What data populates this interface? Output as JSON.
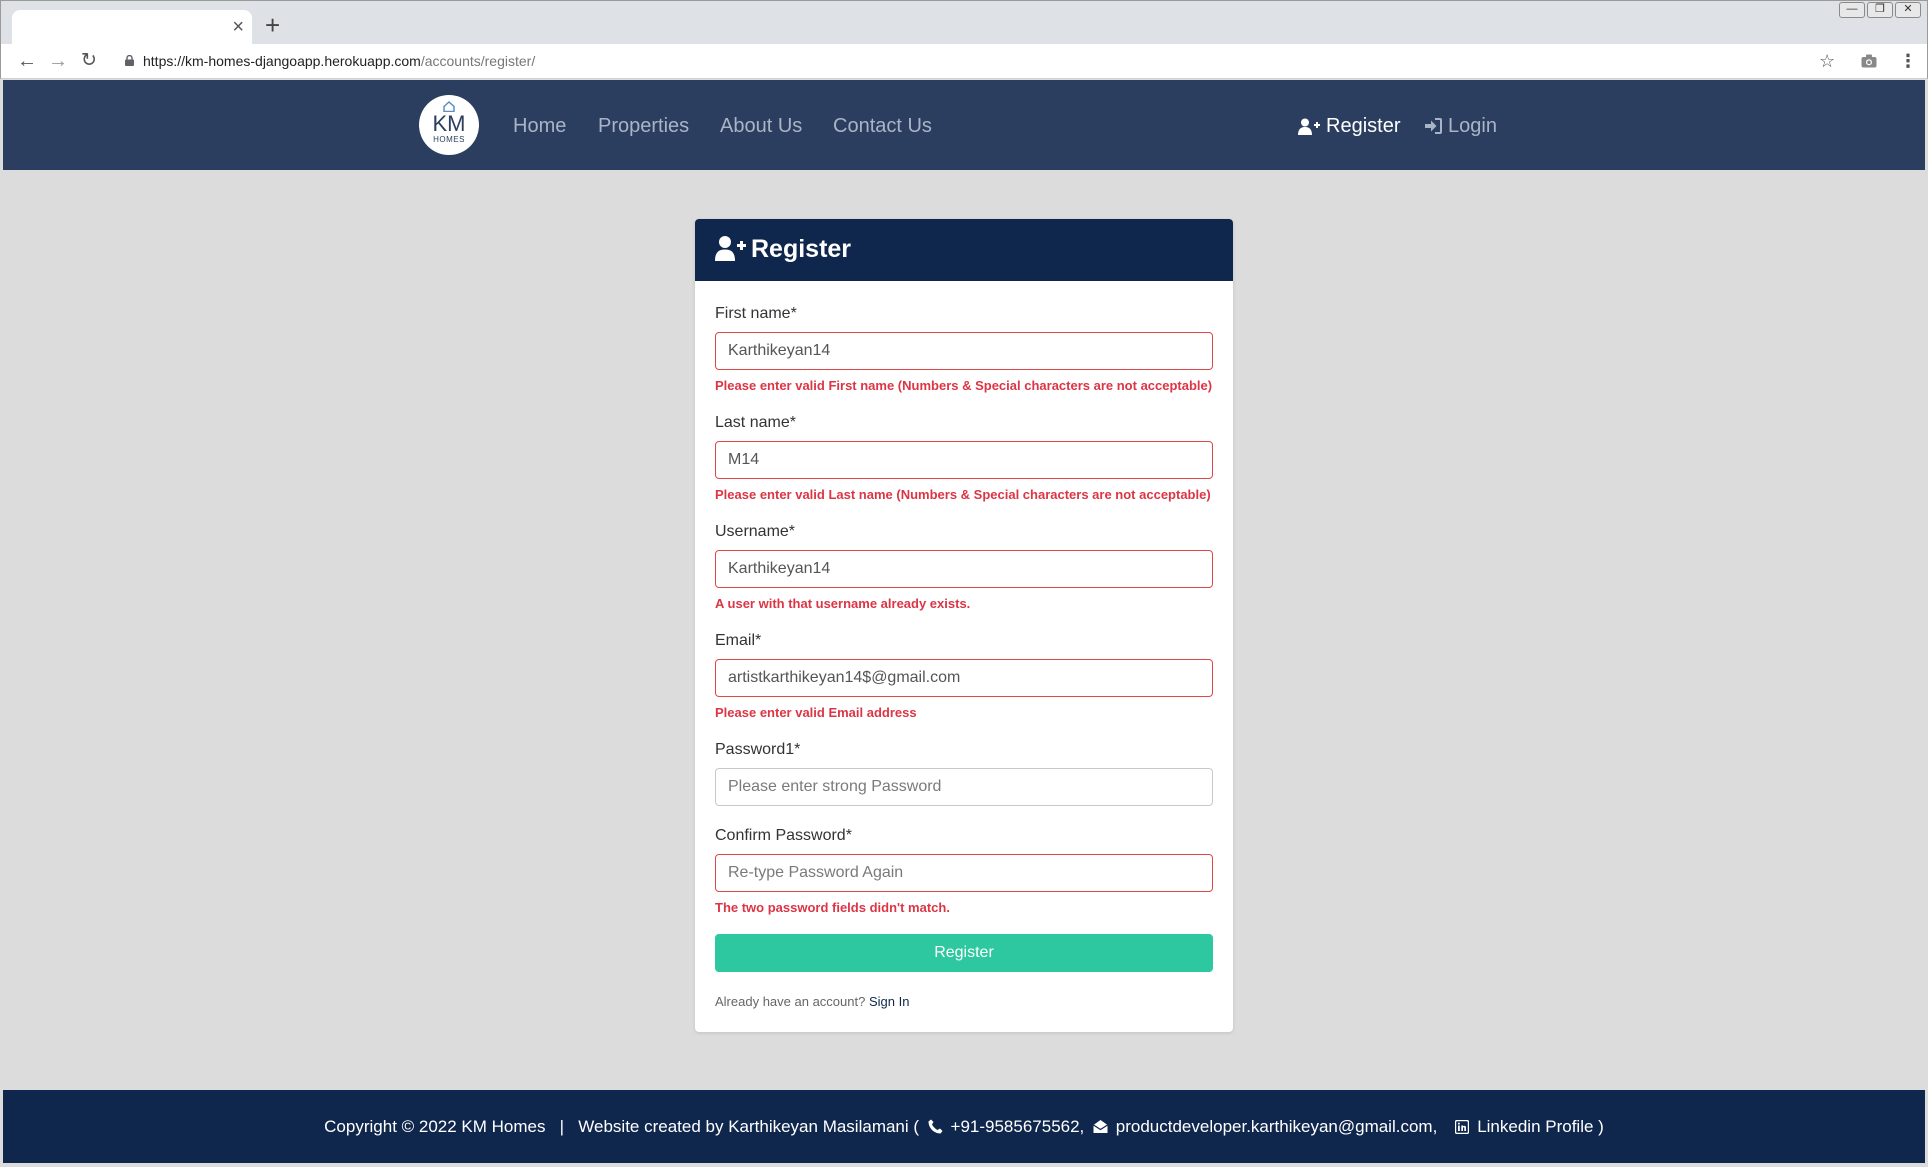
{
  "browser": {
    "url_host": "https://km-homes-djangoapp.herokuapp.com",
    "url_path": "/accounts/register/",
    "new_tab_glyph": "+",
    "close_tab_glyph": "×"
  },
  "navbar": {
    "logo_km": "KM",
    "logo_homes": "HOMES",
    "links": [
      "Home",
      "Properties",
      "About Us",
      "Contact Us"
    ],
    "register": "Register",
    "login": "Login"
  },
  "form": {
    "title": "Register",
    "first_name": {
      "label": "First name*",
      "value": "Karthikeyan14",
      "error": "Please enter valid First name (Numbers & Special characters are not acceptable)"
    },
    "last_name": {
      "label": "Last name*",
      "value": "M14",
      "error": "Please enter valid Last name (Numbers & Special characters are not acceptable)"
    },
    "username": {
      "label": "Username*",
      "value": "Karthikeyan14",
      "error": "A user with that username already exists."
    },
    "email": {
      "label": "Email*",
      "value": "artistkarthikeyan14$@gmail.com",
      "error": "Please enter valid Email address"
    },
    "password1": {
      "label": "Password1*",
      "placeholder": "Please enter strong Password"
    },
    "password2": {
      "label": "Confirm Password*",
      "placeholder": "Re-type Password Again",
      "error": "The two password fields didn't match."
    },
    "submit": "Register",
    "already": "Already have an account?",
    "signin": "Sign In"
  },
  "footer": {
    "copyright": "Copyright © 2022 KM Homes",
    "separator": "|",
    "created_by": "Website created by Karthikeyan Masilamani (",
    "phone": "+91-9585675562,",
    "email": "productdeveloper.karthikeyan@gmail.com,",
    "linkedin": "Linkedin Profile )"
  },
  "colors": {
    "navbar": "#2c3e60",
    "card_header": "#10274d",
    "footer": "#10274d",
    "error": "#dc3545",
    "submit": "#2dc8a0"
  }
}
